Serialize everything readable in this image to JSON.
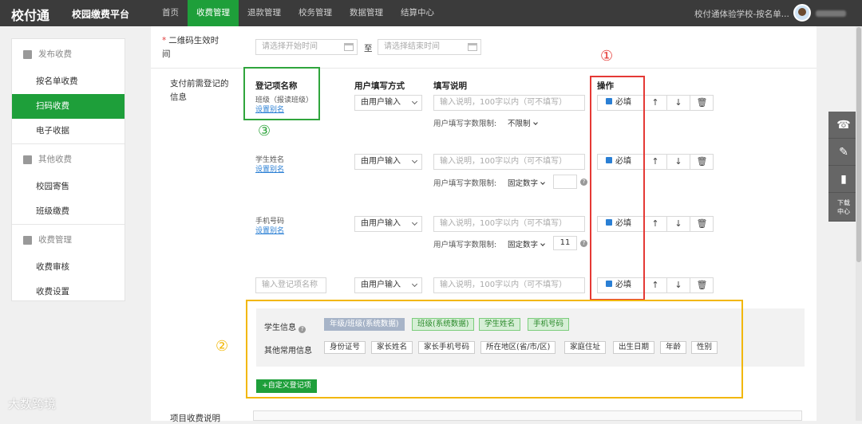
{
  "topbar": {
    "logo": "校付通",
    "app_title": "校园缴费平台",
    "nav": [
      "首页",
      "收费管理",
      "退款管理",
      "校务管理",
      "数据管理",
      "结算中心"
    ],
    "school": "校付通体验学校-按名单..."
  },
  "sidebar": {
    "group1": "发布收费",
    "group1_items": [
      "按名单收费",
      "扫码收费",
      "电子收据"
    ],
    "group2": "其他收费",
    "group2_items": [
      "校园寄售",
      "班级缴费"
    ],
    "group3": "收费管理",
    "group3_items": [
      "收费审核",
      "收费设置"
    ]
  },
  "qr": {
    "label": "二维码生效时间",
    "start_placeholder": "请选择开始时间",
    "to": "至",
    "end_placeholder": "请选择结束时间"
  },
  "reg": {
    "label": "支付前需登记的信息",
    "headers": {
      "name": "登记项名称",
      "method": "用户填写方式",
      "desc": "填写说明",
      "ops": "操作"
    },
    "rows": [
      {
        "name": "班级（报读班级）",
        "alias": "设置别名",
        "method": "由用户输入",
        "desc_ph": "输入说明，100字以内（可不填写）",
        "limit_label": "用户填写字数限制:",
        "limit_val": "不限制",
        "limit_num": "",
        "required": "必填"
      },
      {
        "name": "学生姓名",
        "alias": "设置别名",
        "method": "由用户输入",
        "desc_ph": "输入说明，100字以内（可不填写）",
        "limit_label": "用户填写字数限制:",
        "limit_val": "固定数字",
        "limit_num": "",
        "required": "必填"
      },
      {
        "name": "手机号码",
        "alias": "设置别名",
        "method": "由用户输入",
        "desc_ph": "输入说明，100字以内（可不填写）",
        "limit_label": "用户填写字数限制:",
        "limit_val": "固定数字",
        "limit_num": "11",
        "required": "必填"
      },
      {
        "name_ph": "输入登记项名称",
        "method": "由用户输入",
        "desc_ph": "输入说明，100字以内（可不填写）",
        "required": "必填"
      }
    ]
  },
  "info": {
    "student_label": "学生信息",
    "student_tags": [
      "年级/班级(系统数据)",
      "班级(系统数据)",
      "学生姓名",
      "手机号码"
    ],
    "common_label": "其他常用信息",
    "common_tags": [
      "身份证号",
      "家长姓名",
      "家长手机号码",
      "所在地区(省/市/区)",
      "家庭住址",
      "出生日期",
      "年龄",
      "性别"
    ],
    "custom_btn": "+自定义登记项"
  },
  "annotations": {
    "red": "①",
    "yellow": "②",
    "green": "③"
  },
  "float_tools": {
    "download": "下载",
    "center": "中心"
  },
  "bottom": {
    "label": "项目收费说明"
  },
  "watermark": "大数跨境",
  "colors": {
    "accent": "#1e9f3a",
    "red": "#e53935",
    "yellow": "#f2b705",
    "green": "#2fa53c"
  }
}
